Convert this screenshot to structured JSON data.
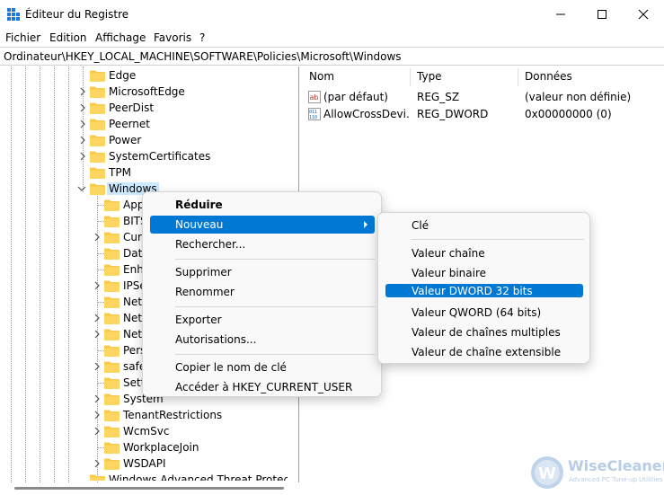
{
  "window": {
    "title": "Éditeur du Registre",
    "menu": [
      "Fichier",
      "Edition",
      "Affichage",
      "Favoris",
      "?"
    ],
    "address": "Ordinateur\\HKEY_LOCAL_MACHINE\\SOFTWARE\\Policies\\Microsoft\\Windows"
  },
  "tree": {
    "items": [
      {
        "label": "Edge",
        "expand": "none"
      },
      {
        "label": "MicrosoftEdge",
        "expand": "collapsed"
      },
      {
        "label": "PeerDist",
        "expand": "collapsed"
      },
      {
        "label": "Peernet",
        "expand": "collapsed"
      },
      {
        "label": "Power",
        "expand": "collapsed"
      },
      {
        "label": "SystemCertificates",
        "expand": "collapsed"
      },
      {
        "label": "TPM",
        "expand": "none"
      },
      {
        "label": "Windows",
        "expand": "expanded"
      }
    ],
    "children": [
      {
        "label": "App",
        "expand": "none"
      },
      {
        "label": "BITS",
        "expand": "none"
      },
      {
        "label": "Cur",
        "expand": "collapsed"
      },
      {
        "label": "Data",
        "expand": "none"
      },
      {
        "label": "Enh",
        "expand": "none"
      },
      {
        "label": "IPSe",
        "expand": "collapsed"
      },
      {
        "label": "Net",
        "expand": "none"
      },
      {
        "label": "Net",
        "expand": "collapsed"
      },
      {
        "label": "Net",
        "expand": "collapsed"
      },
      {
        "label": "Pers",
        "expand": "none"
      },
      {
        "label": "safe",
        "expand": "collapsed"
      },
      {
        "label": "Sett",
        "expand": "none"
      },
      {
        "label": "System",
        "expand": "collapsed"
      },
      {
        "label": "TenantRestrictions",
        "expand": "collapsed"
      },
      {
        "label": "WcmSvc",
        "expand": "collapsed"
      },
      {
        "label": "WorkplaceJoin",
        "expand": "none"
      },
      {
        "label": "WSDAPI",
        "expand": "collapsed"
      }
    ],
    "last_partial": "Windows Advanced Threat Protection"
  },
  "list": {
    "columns": [
      "Nom",
      "Type",
      "Données"
    ],
    "rows": [
      {
        "name": "(par défaut)",
        "type": "REG_SZ",
        "data": "(valeur non définie)",
        "icon": "string-value-icon"
      },
      {
        "name": "AllowCrossDevi...",
        "type": "REG_DWORD",
        "data": "0x00000000 (0)",
        "icon": "dword-value-icon"
      }
    ]
  },
  "context_menu": {
    "items": [
      "Réduire",
      "Nouveau",
      "Rechercher...",
      "Supprimer",
      "Renommer",
      "Exporter",
      "Autorisations...",
      "Copier le nom de clé",
      "Accéder à HKEY_CURRENT_USER"
    ]
  },
  "submenu": {
    "items": [
      "Clé",
      "Valeur chaîne",
      "Valeur binaire",
      "Valeur DWORD 32 bits",
      "Valeur QWORD (64 bits)",
      "Valeur de chaînes multiples",
      "Valeur de chaîne extensible"
    ]
  },
  "watermark": {
    "name": "WiseCleaner",
    "tagline": "Advanced PC Tune-up Utilities"
  },
  "colors": {
    "accent": "#0078d4",
    "folder": "#f8c94a",
    "selection": "#cce8ff"
  }
}
